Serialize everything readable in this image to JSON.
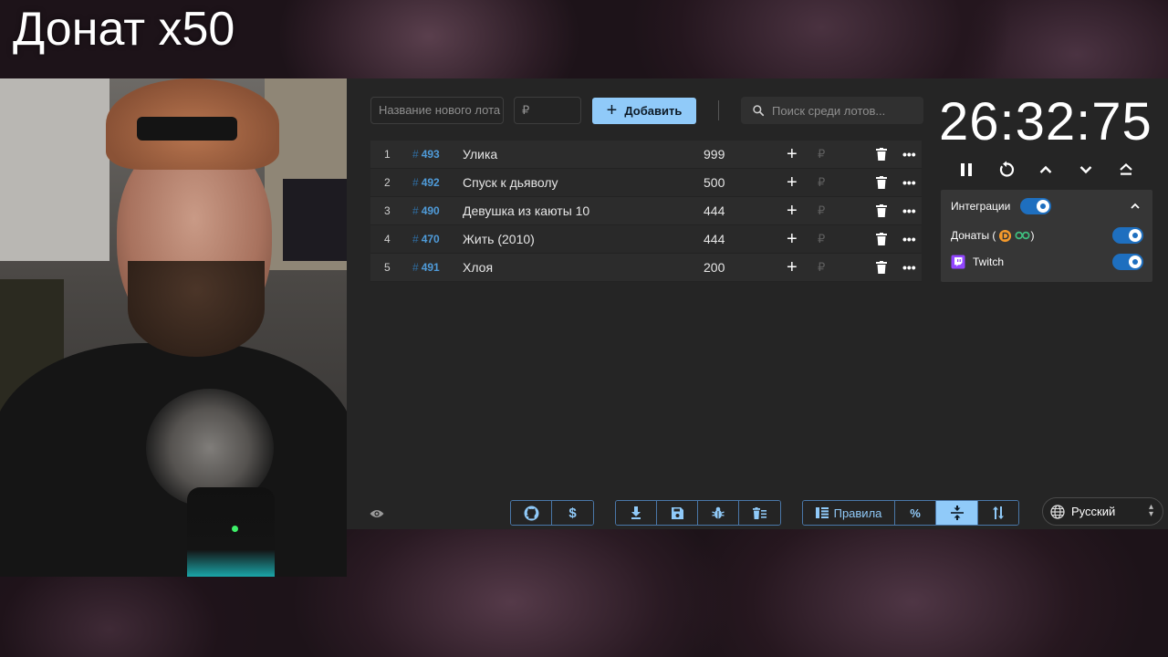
{
  "stream": {
    "overlay_title": "Донат x50"
  },
  "top_bar": {
    "lot_name_placeholder": "Название нового лота",
    "price_placeholder": "₽",
    "add_button_label": "Добавить",
    "search_placeholder": "Поиск среди лотов..."
  },
  "lots": [
    {
      "rank": "1",
      "id": "493",
      "name": "Улика",
      "amount": "999"
    },
    {
      "rank": "2",
      "id": "492",
      "name": "Спуск к дьяволу",
      "amount": "500"
    },
    {
      "rank": "3",
      "id": "490",
      "name": "Девушка из каюты 10",
      "amount": "444"
    },
    {
      "rank": "4",
      "id": "470",
      "name": "Жить (2010)",
      "amount": "444"
    },
    {
      "rank": "5",
      "id": "491",
      "name": "Хлоя",
      "amount": "200"
    }
  ],
  "lot_row_currency": "₽",
  "timer": {
    "display": "26:32:75"
  },
  "integrations": {
    "header_label": "Интеграции",
    "header_enabled": true,
    "items": [
      {
        "label_prefix": "Донаты (",
        "label_suffix": " )",
        "enabled": true
      },
      {
        "label": "Twitch",
        "enabled": true
      }
    ]
  },
  "bottom_bar": {
    "rules_label": "Правила",
    "percent_label": "%",
    "language": "Русский"
  },
  "colors": {
    "accent": "#90caf9",
    "toggle_on": "#1e6fbf",
    "lot_id": "#4f9bd9",
    "panel_bg": "#252525",
    "twitch": "#9146ff",
    "donation_orange": "#f59a2b",
    "donation_green": "#3fbf7f"
  },
  "icons": {
    "search": "search-icon",
    "pause": "pause-icon",
    "restart": "restart-icon",
    "up": "chevron-up-icon",
    "down": "chevron-down-icon",
    "eject": "eject-icon",
    "github": "github-icon",
    "dollar": "dollar-icon",
    "download": "download-icon",
    "save": "save-icon",
    "bug": "bug-icon",
    "clear": "clear-list-icon",
    "rules": "rules-icon",
    "compress": "compress-icon",
    "sort": "sort-icon",
    "globe": "globe-icon",
    "eye": "eye-icon"
  }
}
